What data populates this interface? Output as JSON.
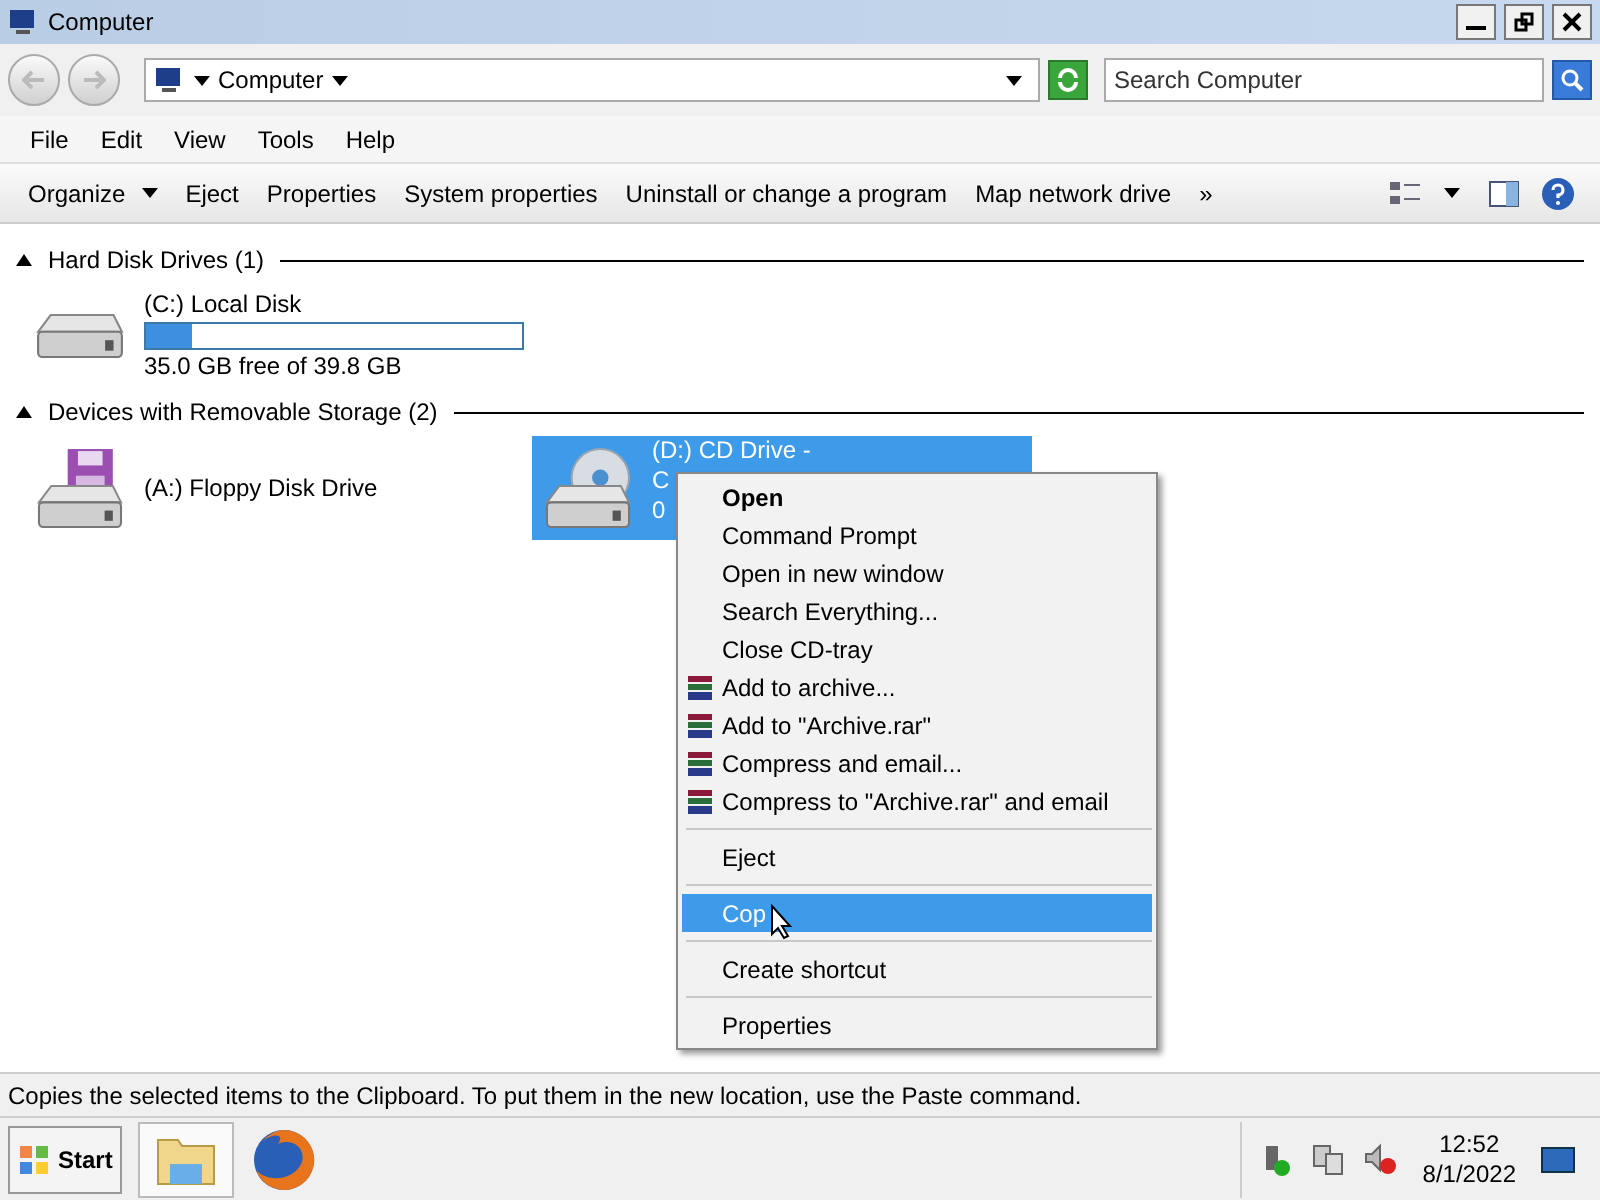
{
  "window": {
    "title": "Computer"
  },
  "address": {
    "location": "Computer",
    "search_placeholder": "Search Computer"
  },
  "menu_bar": [
    "File",
    "Edit",
    "View",
    "Tools",
    "Help"
  ],
  "toolbar": [
    "Organize",
    "Eject",
    "Properties",
    "System properties",
    "Uninstall or change a program",
    "Map network drive",
    "»"
  ],
  "groups": [
    {
      "title": "Hard Disk Drives (1)",
      "expanded": true,
      "items": [
        {
          "kind": "disk",
          "name": "(C:) Local Disk",
          "level": 0.12,
          "info": "35.0 GB free of 39.8 GB",
          "selected": false
        }
      ]
    },
    {
      "title": "Devices with Removable Storage (2)",
      "expanded": true,
      "items": [
        {
          "kind": "floppy",
          "name": "(A:) Floppy Disk Drive",
          "selected": false
        },
        {
          "kind": "cd",
          "name": "(D:) CD Drive -",
          "lines": [
            "C",
            "0"
          ],
          "selected": true
        }
      ]
    }
  ],
  "context_menu": [
    {
      "kind": "item",
      "label": "Open",
      "default": true,
      "rar": false,
      "selected": false
    },
    {
      "kind": "item",
      "label": "Command Prompt",
      "default": false,
      "rar": false,
      "selected": false
    },
    {
      "kind": "item",
      "label": "Open in new window",
      "default": false,
      "rar": false,
      "selected": false
    },
    {
      "kind": "item",
      "label": "Search Everything...",
      "default": false,
      "rar": false,
      "selected": false
    },
    {
      "kind": "item",
      "label": "Close CD-tray",
      "default": false,
      "rar": false,
      "selected": false
    },
    {
      "kind": "item",
      "label": "Add to archive...",
      "default": false,
      "rar": true,
      "selected": false
    },
    {
      "kind": "item",
      "label": "Add to \"Archive.rar\"",
      "default": false,
      "rar": true,
      "selected": false
    },
    {
      "kind": "item",
      "label": "Compress and email...",
      "default": false,
      "rar": true,
      "selected": false
    },
    {
      "kind": "item",
      "label": "Compress to \"Archive.rar\" and email",
      "default": false,
      "rar": true,
      "selected": false
    },
    {
      "kind": "separator"
    },
    {
      "kind": "item",
      "label": "Eject",
      "default": false,
      "rar": false,
      "selected": false
    },
    {
      "kind": "separator"
    },
    {
      "kind": "item",
      "label": "Cop",
      "default": false,
      "rar": false,
      "selected": true
    },
    {
      "kind": "separator"
    },
    {
      "kind": "item",
      "label": "Create shortcut",
      "default": false,
      "rar": false,
      "selected": false
    },
    {
      "kind": "separator"
    },
    {
      "kind": "item",
      "label": "Properties",
      "default": false,
      "rar": false,
      "selected": false
    }
  ],
  "status_bar": "Copies the selected items to the Clipboard. To put them in the new location, use the Paste command.",
  "taskbar": {
    "start": "Start",
    "time": "12:52",
    "date": "8/1/2022"
  }
}
